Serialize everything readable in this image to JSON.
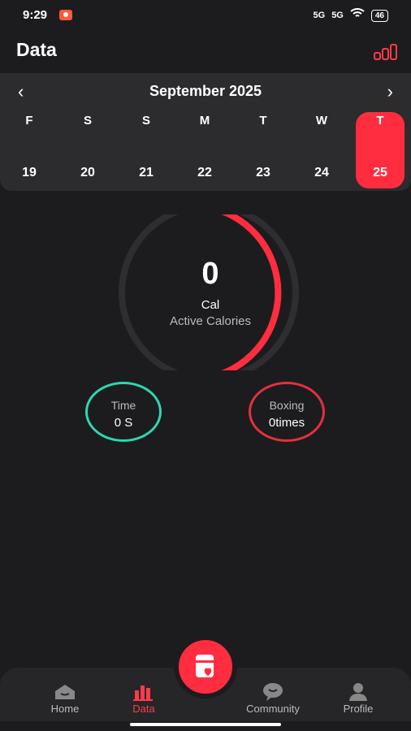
{
  "status_bar": {
    "time": "9:29",
    "signal1": "5G",
    "signal2": "5G",
    "battery": "46"
  },
  "header": {
    "title": "Data",
    "chart_icon": "bar-chart-icon"
  },
  "calendar": {
    "month": "September 2025",
    "prev_icon": "chevron-left-icon",
    "next_icon": "chevron-right-icon",
    "days": [
      {
        "weekday": "F",
        "date": "19"
      },
      {
        "weekday": "S",
        "date": "20"
      },
      {
        "weekday": "S",
        "date": "21"
      },
      {
        "weekday": "M",
        "date": "22"
      },
      {
        "weekday": "T",
        "date": "23"
      },
      {
        "weekday": "W",
        "date": "24"
      },
      {
        "weekday": "T",
        "date": "25"
      }
    ],
    "selected_date": "25"
  },
  "calories": {
    "value": "0",
    "unit": "Cal",
    "label": "Active Calories",
    "accent": "#ff2d3f"
  },
  "stats": {
    "time": {
      "label": "Time",
      "value": "0 S",
      "color": "#2fd6b0"
    },
    "boxing": {
      "label": "Boxing",
      "value": "0times",
      "color": "#e4303f"
    }
  },
  "bottom_nav": {
    "items": [
      {
        "label": "Home",
        "icon": "home-icon"
      },
      {
        "label": "Data",
        "icon": "bar-chart-icon",
        "active": true
      },
      {
        "label": "Community",
        "icon": "chat-bubble-icon"
      },
      {
        "label": "Profile",
        "icon": "person-icon"
      }
    ],
    "fab_icon": "workout-icon"
  }
}
